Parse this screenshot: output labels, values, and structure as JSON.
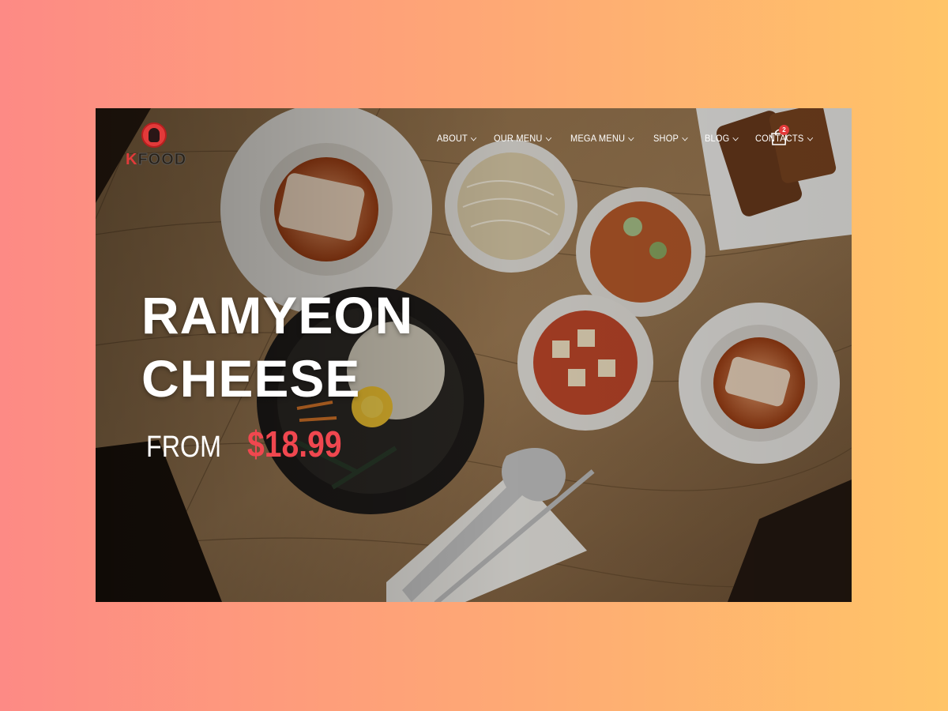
{
  "brand": {
    "logo_text_k": "K",
    "logo_text_rest": "FOOD",
    "accent": "#e23a3a"
  },
  "nav": {
    "items": [
      {
        "label": "ABOUT",
        "has_dropdown": true
      },
      {
        "label": "OUR MENU",
        "has_dropdown": true
      },
      {
        "label": "MEGA MENU",
        "has_dropdown": true
      },
      {
        "label": "SHOP",
        "has_dropdown": true
      },
      {
        "label": "BLOG",
        "has_dropdown": true
      },
      {
        "label": "CONTACTS",
        "has_dropdown": true
      }
    ],
    "cart": {
      "icon": "shopping-bag-icon",
      "count": "2"
    }
  },
  "hero": {
    "title_line1": "RAMYEON",
    "title_line2": "CHEESE",
    "from_label": "FROM",
    "price": "$18.99",
    "price_color": "#f0474f"
  }
}
